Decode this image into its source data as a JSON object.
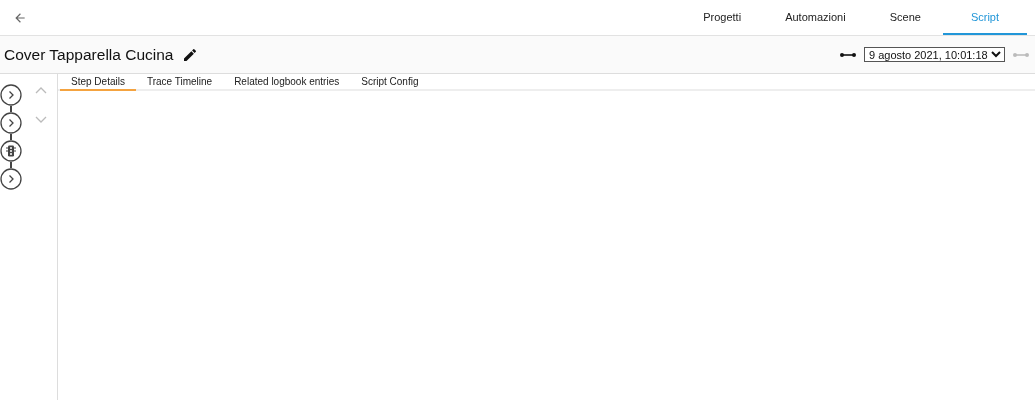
{
  "nav_tabs": [
    {
      "label": "Progetti",
      "selected": false
    },
    {
      "label": "Automazioni",
      "selected": false
    },
    {
      "label": "Scene",
      "selected": false
    },
    {
      "label": "Script",
      "selected": true
    }
  ],
  "title": "Cover Tapparella Cucina",
  "trace_select": {
    "value": "9 agosto 2021, 10:01:18",
    "previous_disabled": false,
    "next_disabled": true
  },
  "graph_nodes": [
    {
      "kind": "action"
    },
    {
      "kind": "action"
    },
    {
      "kind": "condition"
    },
    {
      "kind": "action"
    }
  ],
  "detail_tabs": [
    {
      "label": "Step Details",
      "selected": true
    },
    {
      "label": "Trace Timeline",
      "selected": false
    },
    {
      "label": "Related logbook entries",
      "selected": false
    },
    {
      "label": "Script Config",
      "selected": false
    }
  ]
}
